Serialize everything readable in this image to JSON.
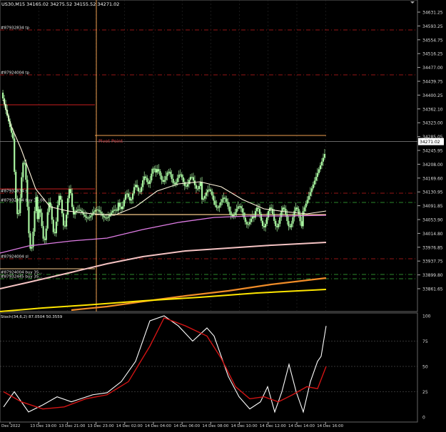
{
  "header": {
    "title": "US30,M15  34165.02 34275.52 34155.52 34271.02"
  },
  "price_axis": {
    "ticks": [
      "34631.25",
      "34593.25",
      "34554.75",
      "34516.25",
      "34477.00",
      "34439.75",
      "34400.25",
      "34362.10",
      "34323.00",
      "34285.05",
      "34245.95",
      "34208.00",
      "34169.60",
      "34130.95",
      "34091.85",
      "34053.90",
      "34014.80",
      "33976.85",
      "33937.75",
      "33899.80",
      "33861.65"
    ],
    "current_price": "34271.02"
  },
  "indicator": {
    "title": "Stoch(34,6,2) 87.0504 50.3559",
    "ticks": [
      "100",
      "75",
      "50",
      "25",
      "0"
    ]
  },
  "time_axis": {
    "ticks": [
      "Dec 2022",
      "13 Dec 19:00",
      "13 Dec 21:00",
      "13 Dec 23:00",
      "14 Dec 02:00",
      "14 Dec 04:00",
      "14 Dec 06:00",
      "14 Dec 08:00",
      "14 Dec 10:00",
      "14 Dec 12:00",
      "14 Dec 14:00",
      "14 Dec 16:00"
    ]
  },
  "annotations": {
    "pivot_point": "Pivot Point",
    "order_labels": [
      "#87932834 tp",
      "#87924004 tp",
      "#87932834 sl",
      "#87932834 buy 35.00",
      "#87924004 sl",
      "#87924004 buy 35...",
      "#87932445 buy 35..."
    ]
  },
  "colors": {
    "background": "#000000",
    "candle": "#a8f5a0",
    "ema_fast": "#fff5dc",
    "ma_magenta": "#e07de6",
    "ma_pink": "#f5c3c3",
    "ma_orange": "#f08c28",
    "ma_yellow": "#ffe600",
    "stoch_main": "#ffffff",
    "stoch_signal": "#d21414",
    "order_line_red": "#c81e1e",
    "order_line_green": "#3cb43c",
    "pivot": "#f0a050"
  },
  "chart_data": {
    "type": "candlestick",
    "title": "US30,M15",
    "ohlc_current": {
      "open": 34165.02,
      "high": 34275.52,
      "low": 34155.52,
      "close": 34271.02
    },
    "ylim": [
      33861.65,
      34650
    ],
    "series": [
      {
        "name": "Stoch(34,6,2) main",
        "last": 87.0504
      },
      {
        "name": "Stoch(34,6,2) signal",
        "last": 50.3559
      }
    ],
    "stoch_ylim": [
      0,
      100
    ]
  }
}
